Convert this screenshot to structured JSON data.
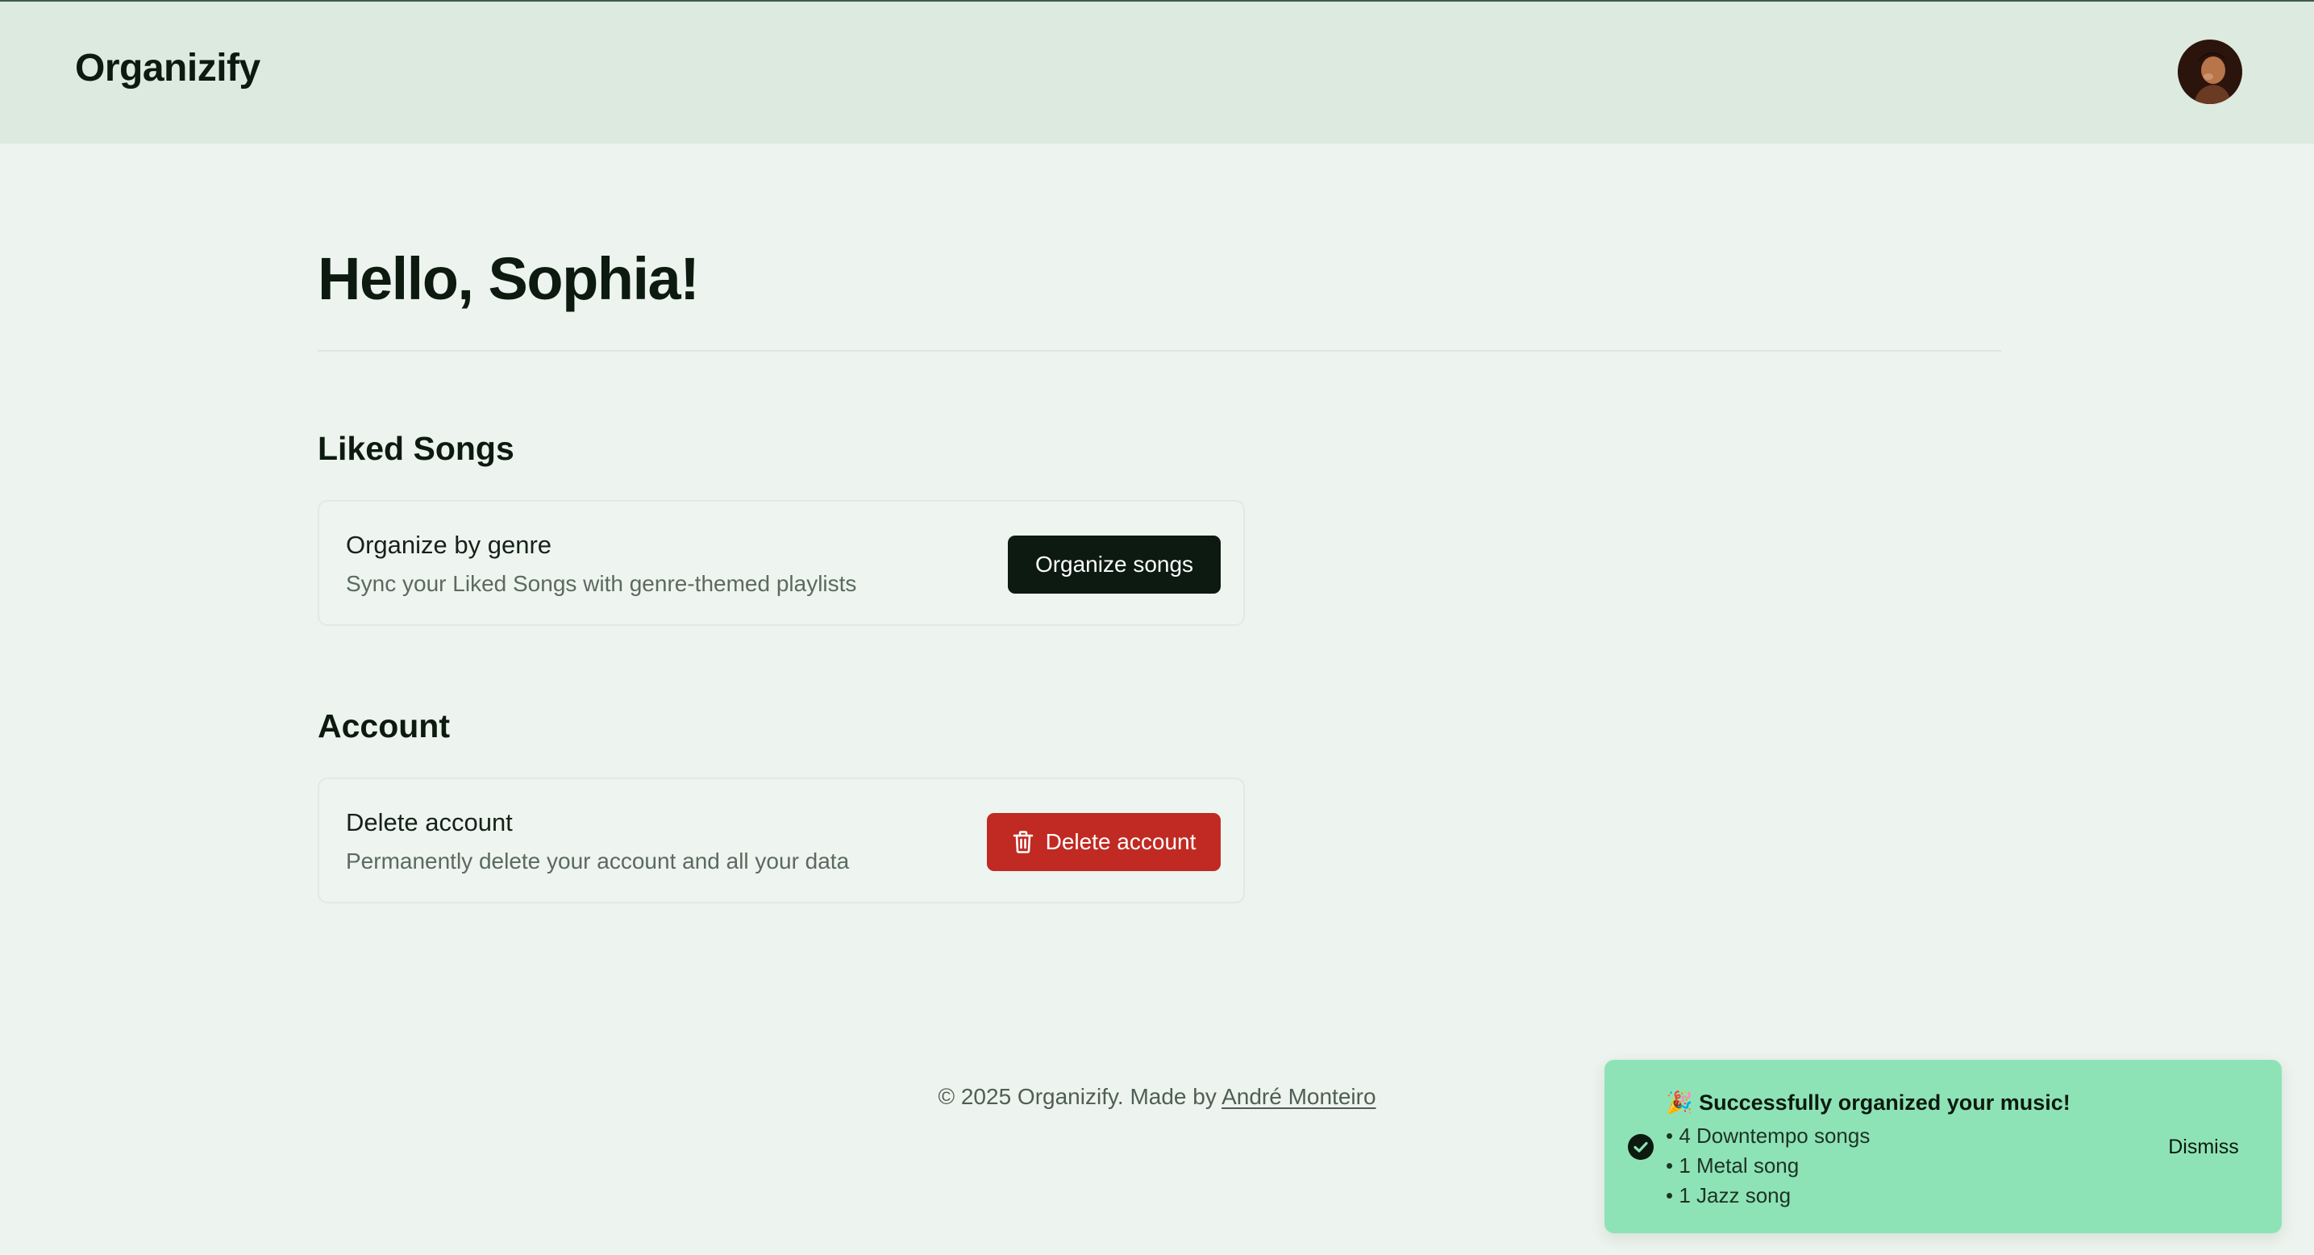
{
  "header": {
    "logo": "Organizify",
    "avatar_alt": "user avatar"
  },
  "main": {
    "greeting": "Hello, Sophia!",
    "liked_songs": {
      "section_title": "Liked Songs",
      "card_title": "Organize by genre",
      "card_description": "Sync your Liked Songs with genre-themed playlists",
      "button_label": "Organize songs"
    },
    "account": {
      "section_title": "Account",
      "card_title": "Delete account",
      "card_description": "Permanently delete your account and all your data",
      "button_label": "Delete account",
      "button_icon": "trash-icon"
    }
  },
  "footer": {
    "text": "© 2025 Organizify. Made by ",
    "author_link": "André Monteiro"
  },
  "toast": {
    "title": "🎉 Successfully organized your music!",
    "items": [
      "4 Downtempo songs",
      "1 Metal song",
      "1 Jazz song"
    ],
    "dismiss_label": "Dismiss",
    "icon": "check-circle-icon"
  },
  "colors": {
    "page_background": "#edf3ee",
    "header_background": "#ddeadf",
    "primary_button": "#0d1a12",
    "danger_button": "#c02a22",
    "toast_background": "#8ee3b6"
  }
}
